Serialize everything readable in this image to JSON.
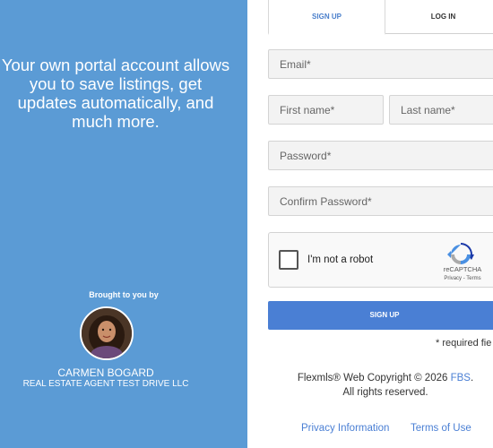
{
  "left_panel": {
    "tagline": "Your own portal account allows you to save listings, get updates automatically, and much more.",
    "brought_by": "Brought to you by",
    "agent_name": "CARMEN BOGARD",
    "agent_company": "REAL ESTATE AGENT TEST DRIVE LLC",
    "background_color": "#5b9bd5"
  },
  "tabs": [
    {
      "label": "SIGN UP",
      "active": true
    },
    {
      "label": "LOG IN",
      "active": false
    }
  ],
  "form": {
    "email_placeholder": "Email*",
    "first_name_placeholder": "First name*",
    "last_name_placeholder": "Last name*",
    "password_placeholder": "Password*",
    "confirm_password_placeholder": "Confirm Password*"
  },
  "captcha": {
    "label": "I'm not a robot",
    "brand": "reCAPTCHA",
    "links": "Privacy - Terms"
  },
  "signup_button": "SIGN UP",
  "required_note": "* required fie",
  "footer": {
    "copyright_prefix": "Flexmls® Web Copyright © 2026 ",
    "fbs_link": "FBS",
    "copyright_suffix": ".",
    "rights": "All rights reserved.",
    "privacy_link": "Privacy Information",
    "terms_link": "Terms of Use"
  },
  "accent_color": "#4a7fd4"
}
